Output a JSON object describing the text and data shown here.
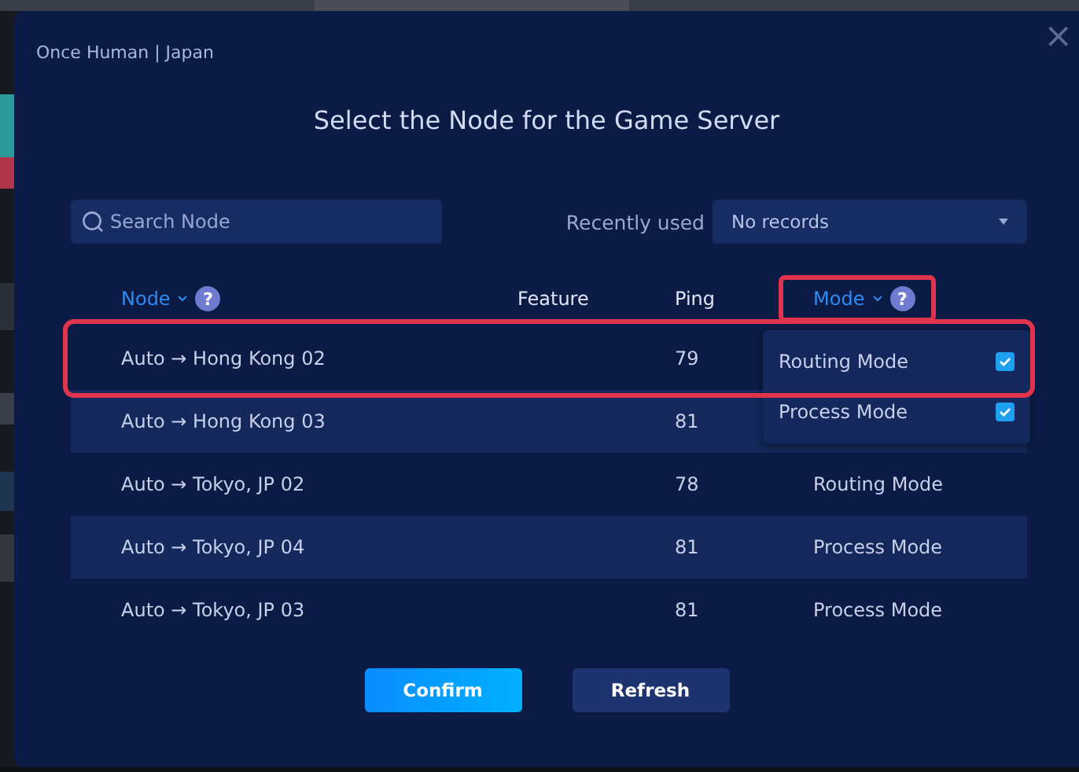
{
  "window": {
    "title": "Once Human | Japan",
    "heading": "Select the Node for the Game Server"
  },
  "close": {
    "label": "×"
  },
  "search": {
    "placeholder": "Search Node"
  },
  "recent": {
    "label": "Recently used",
    "value": "No records"
  },
  "table": {
    "columns": [
      {
        "label": "Node",
        "sortable": true,
        "help": "?",
        "highlighted": false
      },
      {
        "label": "Feature",
        "sortable": false,
        "highlighted": false
      },
      {
        "label": "Ping",
        "sortable": false,
        "highlighted": false
      },
      {
        "label": "Mode",
        "sortable": true,
        "help": "?",
        "highlighted": true
      }
    ],
    "rows": [
      {
        "node": "Auto → Hong Kong 02",
        "ping": "79",
        "highlighted": true
      },
      {
        "node": "Auto → Hong Kong 03",
        "ping": "81",
        "highlighted": false
      },
      {
        "node": "Auto → Tokyo, JP 02",
        "ping": "78",
        "mode": "Routing Mode",
        "highlighted": false
      },
      {
        "node": "Auto → Tokyo, JP 04",
        "ping": "81",
        "mode": "Process Mode",
        "highlighted": false
      },
      {
        "node": "Auto → Tokyo, JP 03",
        "ping": "81",
        "mode": "Process Mode",
        "highlighted": false
      }
    ]
  },
  "mode_filter": {
    "expanded": true,
    "options": [
      {
        "label": "Routing Mode",
        "checked": true
      },
      {
        "label": "Process Mode",
        "checked": true
      }
    ]
  },
  "buttons": [
    {
      "label": "Confirm",
      "kind": "primary"
    },
    {
      "label": "Refresh",
      "kind": "secondary"
    }
  ]
}
